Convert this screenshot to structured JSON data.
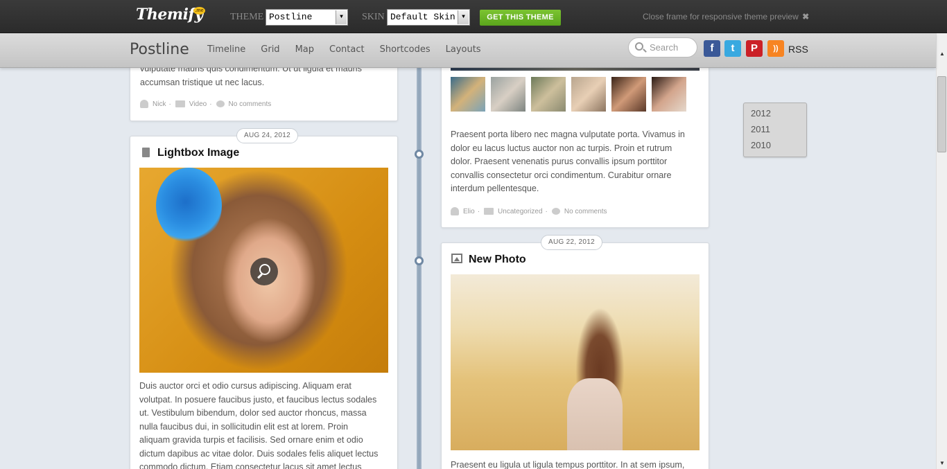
{
  "preview_bar": {
    "logo": "Themify",
    "logo_badge": ".me",
    "theme_label": "THEME",
    "theme_value": "Postline",
    "skin_label": "SKIN",
    "skin_value": "Default Skin",
    "get_button": "GET THIS THEME",
    "close_text": "Close frame for responsive theme preview",
    "close_icon": "✖"
  },
  "header": {
    "site_title": "Postline",
    "nav": [
      "Timeline",
      "Grid",
      "Map",
      "Contact",
      "Shortcodes",
      "Layouts"
    ],
    "search_placeholder": "Search",
    "social": {
      "facebook": "f",
      "twitter": "t",
      "pinterest": "P",
      "rss_icon": "))",
      "rss_label": "RSS"
    }
  },
  "posts": {
    "top_left": {
      "text_line1": "vulputate mauris quis condimentum. Ut ut ligula et mauris",
      "text_line2": "accumsan tristique ut nec lacus.",
      "author": "Nick",
      "category": "Video",
      "comments": "No comments"
    },
    "lightbox": {
      "date": "AUG 24, 2012",
      "title": "Lightbox Image",
      "text": [
        "Duis auctor orci et odio cursus adipiscing. Aliquam erat",
        "volutpat. In posuere faucibus justo, et faucibus lectus sodales",
        "ut. Vestibulum bibendum, dolor sed auctor rhoncus, massa",
        "nulla faucibus dui, in sollicitudin elit est at lorem. Proin",
        "aliquam gravida turpis et facilisis. Sed ornare enim et odio",
        "dictum dapibus ac vitae dolor. Duis sodales felis aliquet lectus",
        "commodo dictum. Etiam consectetur lacus sit amet lectus"
      ]
    },
    "gallery": {
      "text": [
        "Praesent porta libero nec magna vulputate porta. Vivamus in",
        "dolor eu lacus luctus auctor non ac turpis. Proin et rutrum",
        "dolor. Praesent venenatis purus convallis ipsum porttitor",
        "convallis consectetur orci condimentum. Curabitur ornare",
        "interdum pellentesque."
      ],
      "author": "Elio",
      "category": "Uncategorized",
      "comments": "No comments"
    },
    "new_photo": {
      "date": "AUG 22, 2012",
      "title": "New Photo",
      "text_line1": "Praesent eu ligula ut ligula tempus porttitor. In at sem ipsum,"
    }
  },
  "archive": [
    "2012",
    "2011",
    "2010"
  ],
  "colors": {
    "accent_green": "#6ab625",
    "timeline_blue": "#6f88a3",
    "background": "#e4e9ef"
  }
}
